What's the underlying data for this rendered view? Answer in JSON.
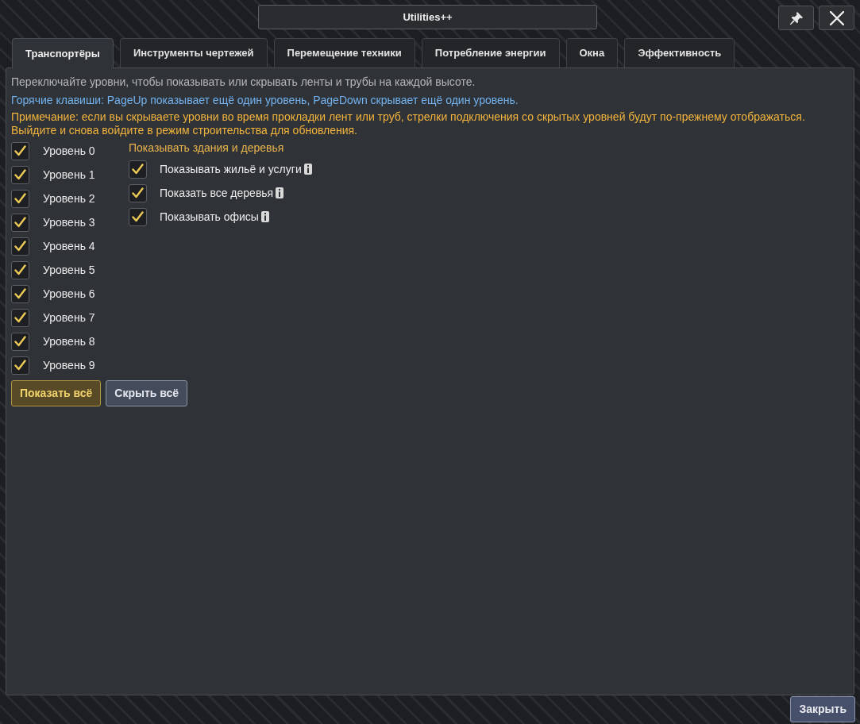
{
  "window": {
    "title": "Utilities++"
  },
  "tabs": [
    {
      "label": "Транспортёры",
      "selected": true
    },
    {
      "label": "Инструменты чертежей",
      "selected": false
    },
    {
      "label": "Перемещение техники",
      "selected": false
    },
    {
      "label": "Потребление энергии",
      "selected": false
    },
    {
      "label": "Окна",
      "selected": false
    },
    {
      "label": "Эффективность",
      "selected": false
    }
  ],
  "panel": {
    "description": "Переключайте уровни, чтобы показывать или скрывать ленты и трубы на каждой высоте.",
    "hotkeys": "Горячие клавиши: PageUp показывает ещё один уровень, PageDown скрывает ещё один уровень.",
    "note": [
      "Примечание: если вы скрываете уровни во время прокладки лент или труб, стрелки подключения со скрытых уровней будут по-прежнему отображаться.",
      "Выйдите и снова войдите в режим строительства для обновления."
    ],
    "levels": [
      {
        "label": "Уровень 0",
        "checked": true
      },
      {
        "label": "Уровень 1",
        "checked": true
      },
      {
        "label": "Уровень 2",
        "checked": true
      },
      {
        "label": "Уровень 3",
        "checked": true
      },
      {
        "label": "Уровень 4",
        "checked": true
      },
      {
        "label": "Уровень 5",
        "checked": true
      },
      {
        "label": "Уровень 6",
        "checked": true
      },
      {
        "label": "Уровень 7",
        "checked": true
      },
      {
        "label": "Уровень 8",
        "checked": true
      },
      {
        "label": "Уровень 9",
        "checked": true
      }
    ],
    "buildings": {
      "heading": "Показывать здания и деревья",
      "options": [
        {
          "label": "Показывать жильё и услуги",
          "checked": true
        },
        {
          "label": "Показать все деревья",
          "checked": true
        },
        {
          "label": "Показывать офисы",
          "checked": true
        }
      ]
    },
    "actions": [
      {
        "label": "Показать всё",
        "kind": "primary"
      },
      {
        "label": "Скрыть всё",
        "kind": "secondary"
      }
    ]
  },
  "footer": {
    "close_button": "Закрыть"
  }
}
